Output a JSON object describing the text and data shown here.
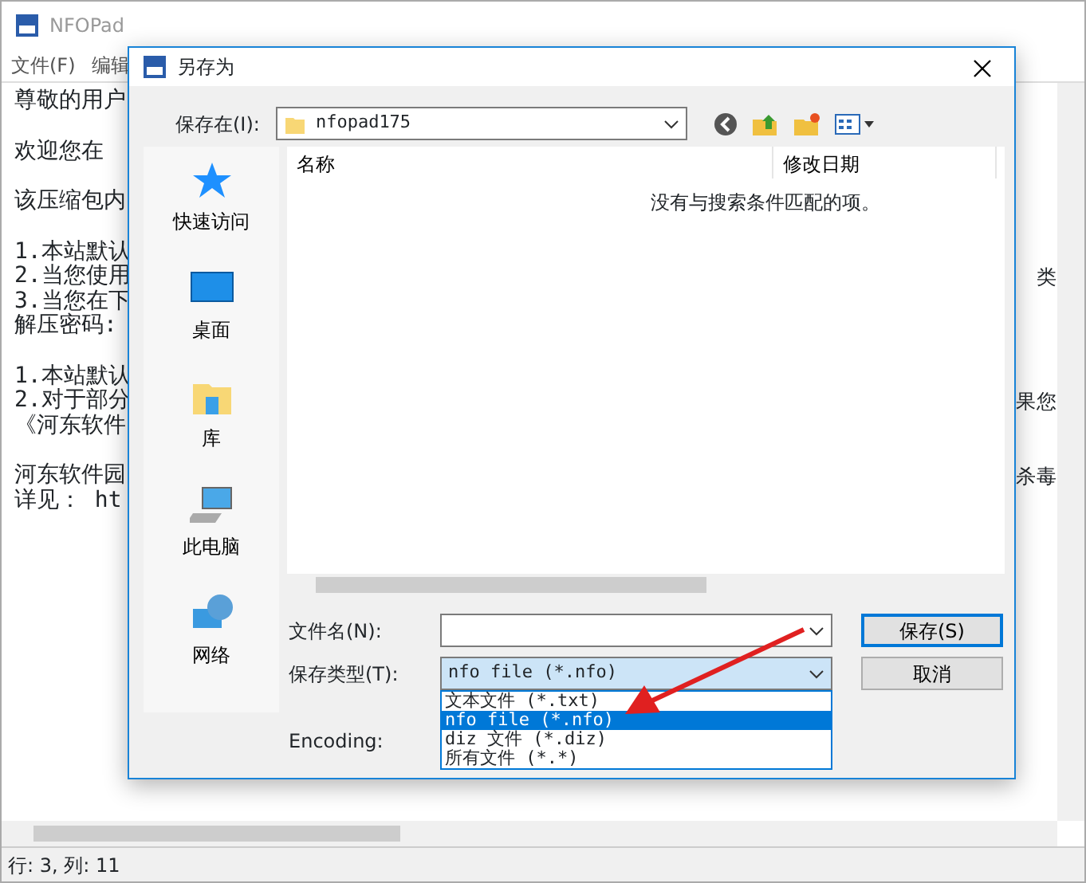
{
  "main_window": {
    "title": "NFOPad",
    "menu": [
      "文件(F)",
      "编辑"
    ],
    "paragraphs": [
      {
        "lines": [
          {
            "text": "尊敬的用户"
          }
        ]
      },
      {
        "lines": [
          {
            "text": "欢迎您在"
          }
        ]
      },
      {
        "lines": [
          {
            "text": "该压缩包内"
          }
        ]
      },
      {
        "lines": [
          {
            "text": "1.本站默认"
          },
          {
            "text": "2.当您使用",
            "right": "类"
          },
          {
            "text": "3.当您在下"
          },
          {
            "text": "解压密码:"
          }
        ]
      },
      {
        "lines": [
          {
            "text": "1.本站默认"
          },
          {
            "text": "2.对于部分",
            "right": "果您"
          },
          {
            "text": "《河东软件"
          }
        ]
      },
      {
        "lines": [
          {
            "text": "河东软件园",
            "right": "杀毒"
          },
          {
            "text": "详见：  ht"
          }
        ]
      }
    ],
    "status_bar": "行: 3, 列: 11"
  },
  "dialog": {
    "title": "另存为",
    "save_in_label": "保存在(I):",
    "folder": "nfopad175",
    "sidebar": [
      {
        "kind": "star",
        "label": "快速访问"
      },
      {
        "kind": "desktop",
        "label": "桌面"
      },
      {
        "kind": "library",
        "label": "库"
      },
      {
        "kind": "computer",
        "label": "此电脑"
      },
      {
        "kind": "network",
        "label": "网络"
      }
    ],
    "columns": [
      "名称",
      "修改日期"
    ],
    "empty_message": "没有与搜索条件匹配的项。",
    "filename_label": "文件名(N):",
    "filetype_label": "保存类型(T):",
    "filetype_value": "nfo file (*.nfo)",
    "filetype_options": [
      {
        "label": "文本文件 (*.txt)",
        "selected": false
      },
      {
        "label": "nfo file (*.nfo)",
        "selected": true
      },
      {
        "label": "diz 文件 (*.diz)",
        "selected": false
      },
      {
        "label": "所有文件 (*.*)",
        "selected": false
      }
    ],
    "encoding_label": "Encoding:",
    "save_button": "保存(S)",
    "cancel_button": "取消"
  }
}
